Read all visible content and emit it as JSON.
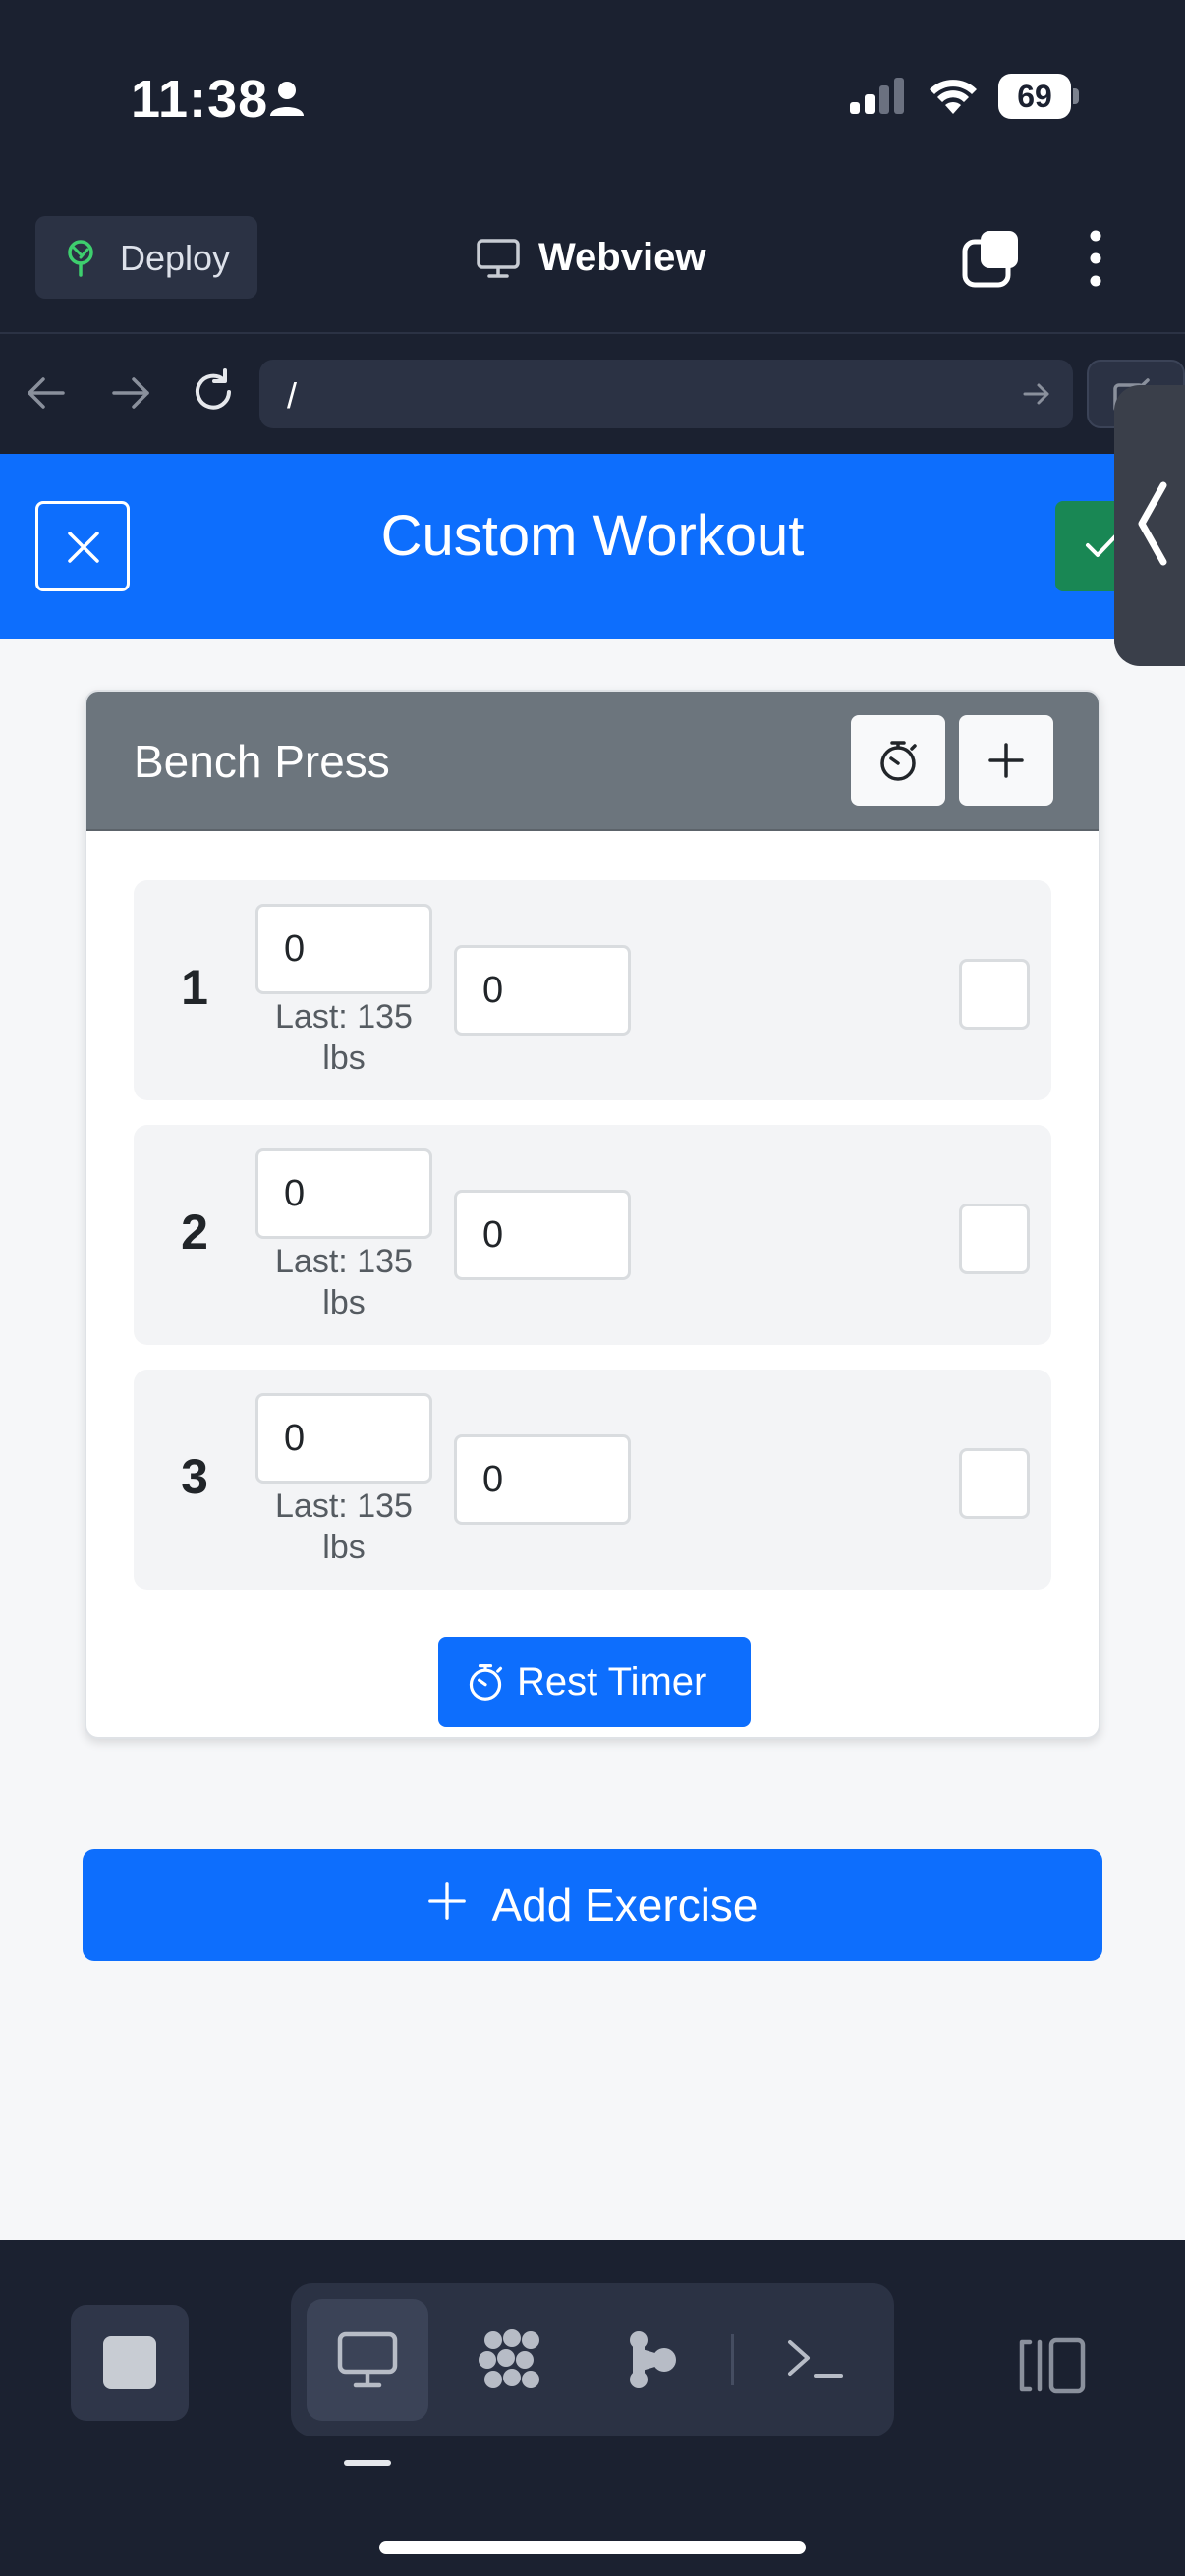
{
  "status_bar": {
    "time": "11:38",
    "battery": "69",
    "icons": [
      "person-icon",
      "cellular-signal-icon",
      "wifi-icon",
      "battery-icon"
    ]
  },
  "top_bar": {
    "deploy_label": "Deploy",
    "title": "Webview",
    "icons": [
      "deploy-tree-icon",
      "monitor-icon",
      "tabs-icon",
      "kebab-menu-icon"
    ]
  },
  "url_bar": {
    "url": "/",
    "icons": [
      "back-arrow-icon",
      "forward-arrow-icon",
      "reload-icon",
      "go-arrow-icon",
      "open-external-icon"
    ]
  },
  "app": {
    "title": "Custom Workout",
    "colors": {
      "primary": "#0d6efd",
      "success": "#198754",
      "card_header": "#6c757d"
    },
    "exercise": {
      "name": "Bench Press",
      "sets": [
        {
          "number": "1",
          "weight": "0",
          "reps": "0",
          "last": "Last: 135 lbs",
          "done": false
        },
        {
          "number": "2",
          "weight": "0",
          "reps": "0",
          "last": "Last: 135 lbs",
          "done": false
        },
        {
          "number": "3",
          "weight": "0",
          "reps": "0",
          "last": "Last: 135 lbs",
          "done": false
        }
      ],
      "rest_timer_label": "Rest Timer"
    },
    "add_exercise_label": "Add Exercise"
  },
  "bottom_bar": {
    "modes": [
      "webview-monitor-icon",
      "cluster-icon",
      "branch-icon",
      "terminal-icon"
    ],
    "active_mode": "webview-monitor-icon"
  }
}
